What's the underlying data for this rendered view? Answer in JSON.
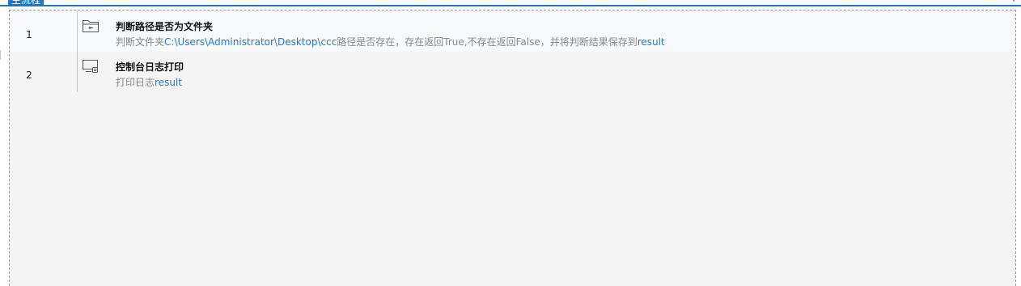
{
  "tab": {
    "label": "主流程"
  },
  "rows": [
    {
      "num": "1",
      "icon": "folder-check-icon",
      "title": "判断路径是否为文件夹",
      "desc": {
        "p1": "判断文件夹",
        "path": "C:\\Users\\Administrator\\Desktop\\ccc",
        "p2": "路径是否存在，存在返回True,不存在返回False，并将判断结果保存到",
        "var": "result"
      }
    },
    {
      "num": "2",
      "icon": "console-print-icon",
      "title": "控制台日志打印",
      "desc": {
        "p1": "打印日志",
        "var": "result"
      }
    }
  ],
  "colors": {
    "accent": "#1979ca",
    "highlight": "#1e7ad7",
    "desc_text": "#8a8a8a"
  }
}
